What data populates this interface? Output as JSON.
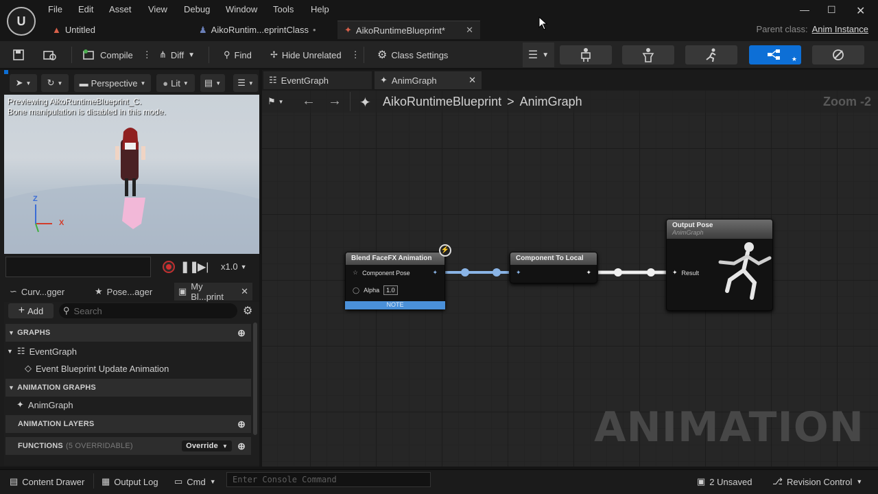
{
  "menu": [
    "File",
    "Edit",
    "Asset",
    "View",
    "Debug",
    "Window",
    "Tools",
    "Help"
  ],
  "doc_tabs": [
    {
      "label": "Untitled",
      "modified": false
    },
    {
      "label": "AikoRuntim...eprintClass",
      "modified": true
    },
    {
      "label": "AikoRuntimeBlueprint*",
      "modified": true
    }
  ],
  "parent_class": {
    "label": "Parent class:",
    "value": "Anim Instance"
  },
  "toolbar": {
    "compile": "Compile",
    "diff": "Diff",
    "find": "Find",
    "hide_unrelated": "Hide Unrelated",
    "class_settings": "Class Settings"
  },
  "viewport": {
    "perspective": "Perspective",
    "lit": "Lit",
    "info_line1": "Previewing AikoRuntimeBlueprint_C.",
    "info_line2": "Bone manipulation is disabled in this mode.",
    "axis_z": "Z",
    "axis_x": "X",
    "speed": "x1.0"
  },
  "left_tabs": [
    "Curv...gger",
    "Pose...ager",
    "My Bl...print"
  ],
  "mybp": {
    "add": "Add",
    "search_placeholder": "Search",
    "graphs": "GRAPHS",
    "event_graph": "EventGraph",
    "event_update": "Event Blueprint Update Animation",
    "animation_graphs": "ANIMATION GRAPHS",
    "anim_graph": "AnimGraph",
    "animation_layers": "ANIMATION LAYERS",
    "functions": "FUNCTIONS",
    "functions_note": "(5 OVERRIDABLE)",
    "override": "Override"
  },
  "graph_tabs": [
    "EventGraph",
    "AnimGraph"
  ],
  "breadcrumb": {
    "root": "AikoRuntimeBlueprint",
    "sep": ">",
    "current": "AnimGraph",
    "zoom": "Zoom -2"
  },
  "nodes": {
    "blend": {
      "title": "Blend FaceFX Animation",
      "pin_pose": "Component Pose",
      "pin_alpha": "Alpha",
      "alpha_value": "1.0",
      "note": "NOTE"
    },
    "comp_to_local": {
      "title": "Component To Local"
    },
    "output": {
      "title": "Output Pose",
      "subtitle": "AnimGraph",
      "pin_result": "Result"
    }
  },
  "watermark": "ANIMATION",
  "status": {
    "content_drawer": "Content Drawer",
    "output_log": "Output Log",
    "cmd": "Cmd",
    "console_placeholder": "Enter Console Command",
    "unsaved": "2 Unsaved",
    "revision": "Revision Control"
  },
  "colors": {
    "accent": "#0d6fd6",
    "wire_pose": "#8ab4e6",
    "node_header": "#5a5a5a"
  }
}
